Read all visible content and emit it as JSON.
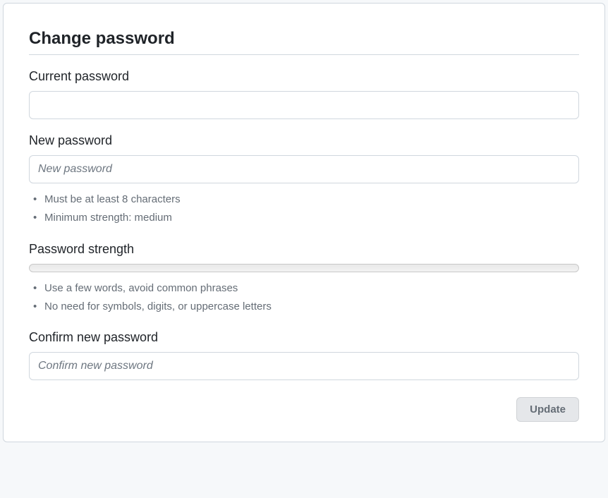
{
  "title": "Change password",
  "currentPassword": {
    "label": "Current password",
    "value": ""
  },
  "newPassword": {
    "label": "New password",
    "placeholder": "New password",
    "value": "",
    "hints": [
      "Must be at least 8 characters",
      "Minimum strength: medium"
    ]
  },
  "strength": {
    "label": "Password strength",
    "value": 0,
    "hints": [
      "Use a few words, avoid common phrases",
      "No need for symbols, digits, or uppercase letters"
    ]
  },
  "confirmPassword": {
    "label": "Confirm new password",
    "placeholder": "Confirm new password",
    "value": ""
  },
  "actions": {
    "update": "Update"
  }
}
